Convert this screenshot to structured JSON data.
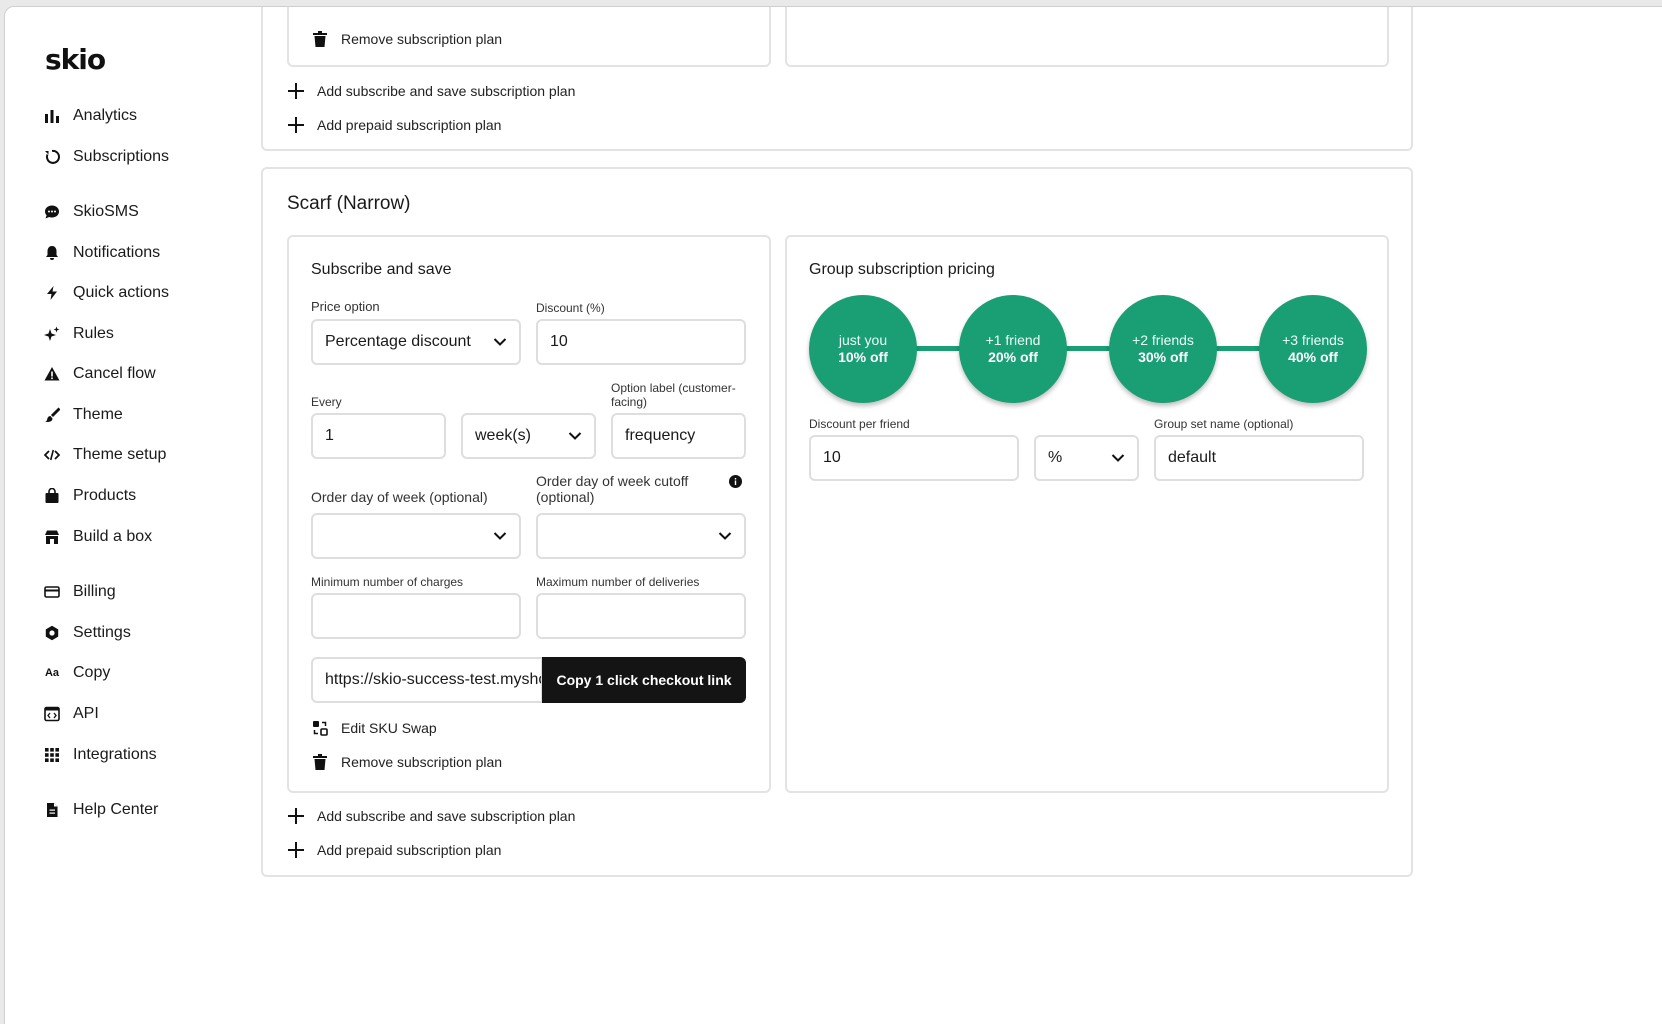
{
  "app": {
    "logo": "skio"
  },
  "sidebar": {
    "items": [
      {
        "label": "Analytics",
        "icon": "bar-chart-icon"
      },
      {
        "label": "Subscriptions",
        "icon": "refresh-icon"
      },
      {
        "label": "SkioSMS",
        "icon": "chat-bubble-icon"
      },
      {
        "label": "Notifications",
        "icon": "bell-icon"
      },
      {
        "label": "Quick actions",
        "icon": "lightning-icon"
      },
      {
        "label": "Rules",
        "icon": "sparkle-icon"
      },
      {
        "label": "Cancel flow",
        "icon": "warning-icon"
      },
      {
        "label": "Theme",
        "icon": "brush-icon"
      },
      {
        "label": "Theme setup",
        "icon": "code-icon"
      },
      {
        "label": "Products",
        "icon": "shopping-bag-icon"
      },
      {
        "label": "Build a box",
        "icon": "store-icon"
      },
      {
        "label": "Billing",
        "icon": "credit-card-icon"
      },
      {
        "label": "Settings",
        "icon": "gear-icon"
      },
      {
        "label": "Copy",
        "icon": "text-aa-icon"
      },
      {
        "label": "API",
        "icon": "api-icon"
      },
      {
        "label": "Integrations",
        "icon": "grid-icon"
      },
      {
        "label": "Help Center",
        "icon": "document-icon"
      }
    ]
  },
  "top_section": {
    "remove_plan": "Remove subscription plan",
    "add_subscribe_save": "Add subscribe and save subscription plan",
    "add_prepaid": "Add prepaid subscription plan"
  },
  "product": {
    "title": "Scarf (Narrow)",
    "subscribe_save": {
      "title": "Subscribe and save",
      "price_option_label": "Price option",
      "price_option_value": "Percentage discount",
      "discount_label": "Discount (%)",
      "discount_value": "10",
      "every_label": "Every",
      "every_value": "1",
      "interval_value": "week(s)",
      "option_label_label": "Option label (customer-facing)",
      "option_label_value": "frequency",
      "order_day_label": "Order day of week (optional)",
      "order_day_cutoff_label": "Order day of week cutoff (optional)",
      "min_charges_label": "Minimum number of charges",
      "max_deliveries_label": "Maximum number of deliveries",
      "checkout_url": "https://skio-success-test.myshopify.com",
      "copy_button": "Copy 1 click checkout link",
      "edit_sku_swap": "Edit SKU Swap",
      "remove_plan": "Remove subscription plan"
    },
    "group_pricing": {
      "title": "Group subscription pricing",
      "tiers": [
        {
          "who": "just you",
          "off": "10% off"
        },
        {
          "who": "+1 friend",
          "off": "20% off"
        },
        {
          "who": "+2 friends",
          "off": "30% off"
        },
        {
          "who": "+3 friends",
          "off": "40% off"
        }
      ],
      "discount_per_friend_label": "Discount per friend",
      "discount_per_friend_value": "10",
      "unit_value": "%",
      "group_set_name_label": "Group set name (optional)",
      "group_set_name_value": "default"
    },
    "add_subscribe_save": "Add subscribe and save subscription plan",
    "add_prepaid": "Add prepaid subscription plan"
  },
  "colors": {
    "accent_green": "#1a9e74",
    "button_dark": "#141414"
  }
}
